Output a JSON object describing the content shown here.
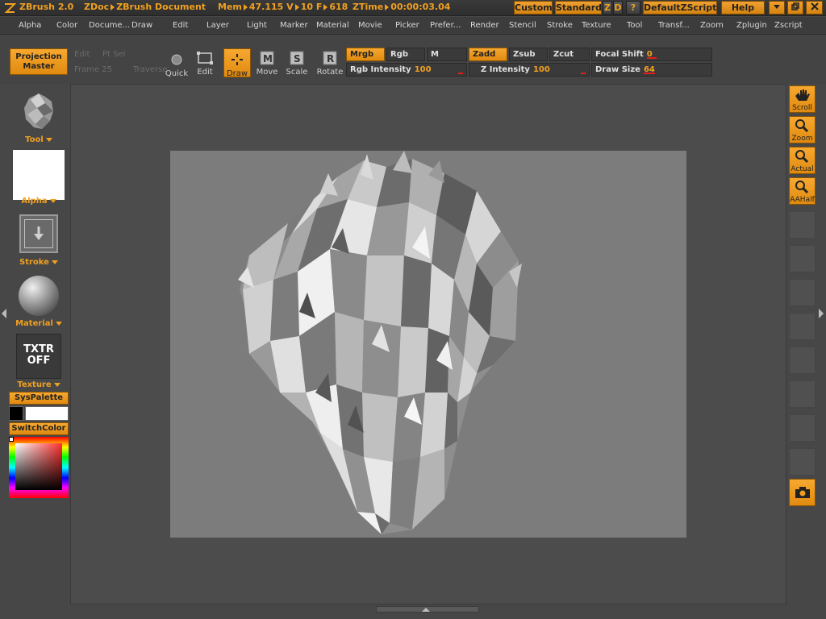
{
  "titlebar": {
    "app_name": "ZBrush 2.0",
    "zdoc": "ZDoc",
    "doc_name": "ZBrush Document",
    "mem_label": "Mem",
    "mem_value": "47.115",
    "v_label": "V",
    "v_value": "10",
    "f_label": "F",
    "f_value": "618",
    "ztime_label": "ZTime",
    "ztime_value": "00:00:03.04",
    "buttons": {
      "custom": "Custom",
      "standard": "Standard",
      "z": "Z",
      "d": "D",
      "help_q": "?",
      "default_zscript": "DefaultZScript",
      "help": "Help"
    }
  },
  "menu": [
    "Alpha",
    "Color",
    "Docume...",
    "Draw",
    "Edit",
    "Layer",
    "Light",
    "Marker",
    "Material",
    "Movie",
    "Picker",
    "Prefer...",
    "Render",
    "Stencil",
    "Stroke",
    "Texture",
    "Tool",
    "Transf...",
    "Zoom",
    "Zplugin",
    "Zscript"
  ],
  "shelf": {
    "projection_master": "Projection Master",
    "faded_row1": [
      "Edit",
      "Pt Sel"
    ],
    "faded_row2": [
      "Frame 25",
      "Traverse"
    ],
    "tools": {
      "quick": "Quick",
      "edit": "Edit",
      "draw": "Draw",
      "move": "Move",
      "scale": "Scale",
      "rotate": "Rotate"
    },
    "modes": {
      "mrgb": "Mrgb",
      "rgb": "Rgb",
      "m": "M",
      "zadd": "Zadd",
      "zsub": "Zsub",
      "zcut": "Zcut"
    },
    "sliders": {
      "focal_shift_label": "Focal Shift",
      "focal_shift_value": "0",
      "rgb_intensity_label": "Rgb Intensity",
      "rgb_intensity_value": "100",
      "z_intensity_label": "Z Intensity",
      "z_intensity_value": "100",
      "draw_size_label": "Draw Size",
      "draw_size_value": "64"
    }
  },
  "left_tray": {
    "tool": "Tool",
    "alpha": "Alpha",
    "stroke": "Stroke",
    "material": "Material",
    "texture_badge": "TXTR OFF",
    "texture": "Texture",
    "syspalette": "SysPalette",
    "switchcolor": "SwitchColor"
  },
  "right_tray": {
    "scroll": "Scroll",
    "zoom": "Zoom",
    "actual": "Actual",
    "aahalf": "AAHalf"
  },
  "colors": {
    "accent": "#f0a020",
    "canvas_bg": "#7c7c7c",
    "ui_bg": "#474747",
    "primary_color": "#000000",
    "secondary_color": "#ffffff"
  }
}
